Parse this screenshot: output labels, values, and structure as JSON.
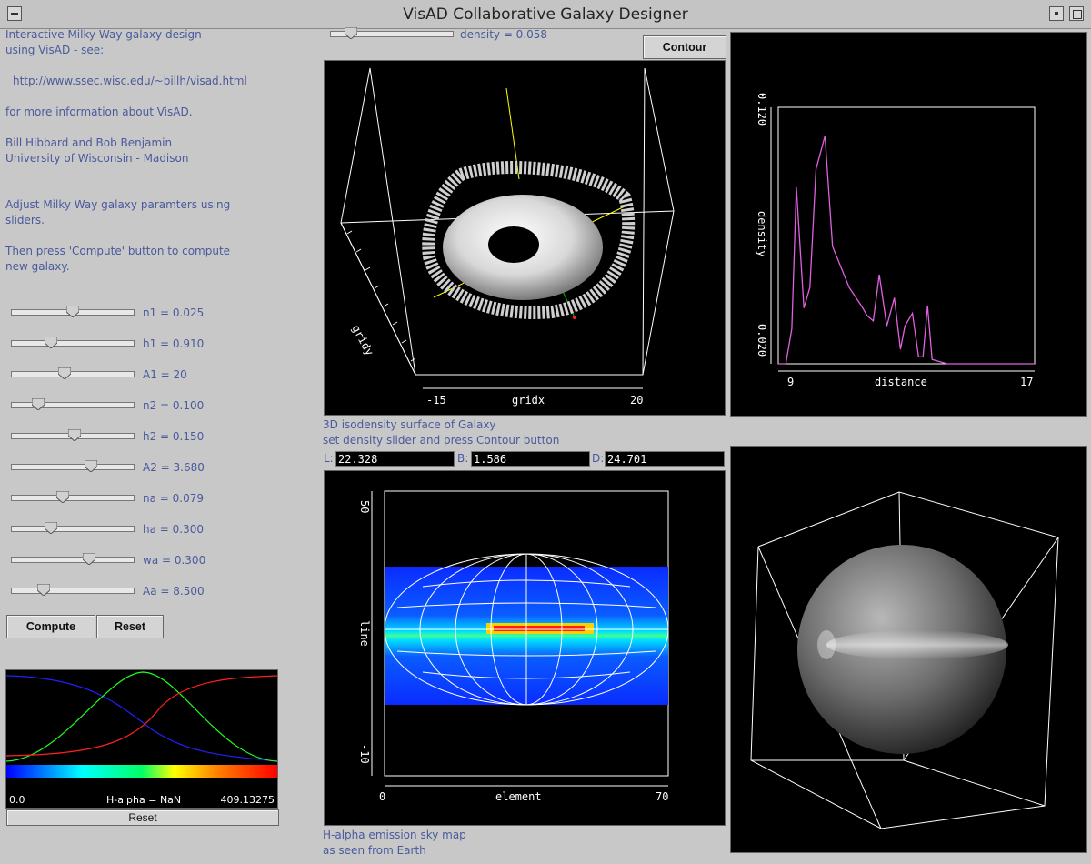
{
  "window": {
    "title": "VisAD Collaborative Galaxy Designer"
  },
  "info": {
    "line1": "Interactive Milky Way galaxy design",
    "line2": "using VisAD  - see:",
    "url": "http://www.ssec.wisc.edu/~billh/visad.html",
    "line3": "for more information about VisAD.",
    "author1": "Bill Hibbard and Bob Benjamin",
    "author2": "University of Wisconsin - Madison",
    "adjust1": "Adjust Milky Way galaxy paramters using",
    "adjust2": "sliders.",
    "then1": "Then press 'Compute' button to compute",
    "then2": "new galaxy."
  },
  "params": [
    {
      "label": "n1 = 0.025",
      "pos": 0.5
    },
    {
      "label": "h1 = 0.910",
      "pos": 0.3
    },
    {
      "label": "A1 = 20",
      "pos": 0.43
    },
    {
      "label": "n2 = 0.100",
      "pos": 0.19
    },
    {
      "label": "h2 = 0.150",
      "pos": 0.52
    },
    {
      "label": "A2 = 3.680",
      "pos": 0.66
    },
    {
      "label": "na = 0.079",
      "pos": 0.41
    },
    {
      "label": "ha = 0.300",
      "pos": 0.3
    },
    {
      "label": "wa = 0.300",
      "pos": 0.65
    },
    {
      "label": "Aa = 8.500",
      "pos": 0.24
    }
  ],
  "buttons": {
    "compute": "Compute",
    "reset": "Reset",
    "contour": "Contour",
    "colormap_reset": "Reset"
  },
  "density": {
    "label": "density = 0.058",
    "pos": 0.13
  },
  "colormap": {
    "min": "0.0",
    "max": "409.13275",
    "readout": "H-alpha = NaN"
  },
  "iso3d": {
    "caption1": "3D isodensity surface of Galaxy",
    "caption2": "set density slider and press Contour button",
    "xlabel": "gridx",
    "ylabel": "gridy",
    "x_ticks": [
      "-15",
      "20"
    ]
  },
  "coords": {
    "L_label": "L:",
    "L_value": "22.328",
    "B_label": "B:",
    "B_value": "1.586",
    "D_label": "D:",
    "D_value": "24.701"
  },
  "skymap": {
    "caption1": "H-alpha emission sky map",
    "caption2": "as seen from Earth",
    "xlabel": "element",
    "ylabel": "line",
    "x_ticks": [
      "0",
      "70"
    ],
    "y_ticks": [
      "50",
      "-10"
    ]
  },
  "colors": {
    "accent_text": "#4a5a9c",
    "profile_line": "#e060e0"
  },
  "chart_data": {
    "type": "line",
    "title": "",
    "xlabel": "distance",
    "ylabel": "density",
    "xlim": [
      8.5,
      17
    ],
    "ylim": [
      0.02,
      0.12
    ],
    "x_ticks": [
      "9",
      "17"
    ],
    "y_ticks": [
      "0.120",
      "0.020"
    ],
    "x": [
      8.5,
      8.75,
      8.95,
      9.1,
      9.35,
      9.55,
      9.75,
      10.05,
      10.3,
      10.85,
      11.25,
      11.45,
      11.65,
      11.85,
      12.1,
      12.35,
      12.55,
      12.7,
      12.95,
      13.15,
      13.3,
      13.45,
      13.6,
      14.1,
      14.8,
      16.0,
      17.0
    ],
    "y": [
      0.028,
      0.029,
      0.045,
      0.1,
      0.053,
      0.061,
      0.107,
      0.12,
      0.077,
      0.061,
      0.054,
      0.05,
      0.048,
      0.066,
      0.046,
      0.057,
      0.037,
      0.046,
      0.051,
      0.034,
      0.034,
      0.054,
      0.033,
      0.03,
      0.027,
      0.022,
      0.019
    ]
  }
}
